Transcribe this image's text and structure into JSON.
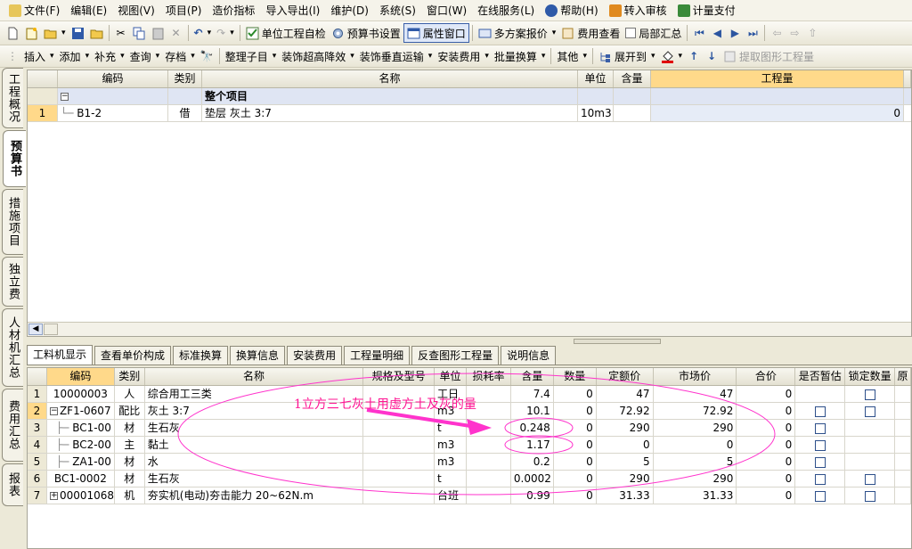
{
  "menu": [
    {
      "label": "文件(F)",
      "icon": "file-menu-icon"
    },
    {
      "label": "编辑(E)"
    },
    {
      "label": "视图(V)"
    },
    {
      "label": "项目(P)"
    },
    {
      "label": "造价指标"
    },
    {
      "label": "导入导出(I)"
    },
    {
      "label": "维护(D)"
    },
    {
      "label": "系统(S)"
    },
    {
      "label": "窗口(W)"
    },
    {
      "label": "在线服务(L)"
    },
    {
      "label": "帮助(H)",
      "icon": "help-icon"
    },
    {
      "label": "转入审核",
      "icon": "audit-icon"
    },
    {
      "label": "计量支付",
      "icon": "payment-icon"
    }
  ],
  "toolbar1": {
    "unit_check": "单位工程自检",
    "budget_settings": "预算书设置",
    "property_window": "属性窗口",
    "multi_quote": "多方案报价",
    "fee_view": "费用查看",
    "partial_sum": "局部汇总"
  },
  "toolbar2": {
    "insert": "插入",
    "add": "添加",
    "supplement": "补充",
    "query": "查询",
    "archive": "存档",
    "arrange": "整理子目",
    "deco_height": "装饰超高降效",
    "deco_transport": "装饰垂直运输",
    "install_fee": "安装费用",
    "batch_convert": "批量换算",
    "other": "其他",
    "expand_to": "展开到",
    "extract_qty": "提取图形工程量"
  },
  "side_tabs": [
    "工程概况",
    "预算书",
    "措施项目",
    "独立费",
    "人材机汇总",
    "费用汇总",
    "报表"
  ],
  "upper_grid": {
    "headers": [
      "编码",
      "类别",
      "名称",
      "单位",
      "含量",
      "工程量"
    ],
    "group_row": {
      "name": "整个项目",
      "toggle": "−"
    },
    "rows": [
      {
        "num": "1",
        "code": "B1-2",
        "type": "借",
        "name": "垫层 灰土 3:7",
        "unit": "10m3",
        "content": "",
        "qty": "0"
      }
    ]
  },
  "bottom_tabs": [
    "工料机显示",
    "查看单价构成",
    "标准换算",
    "换算信息",
    "安装费用",
    "工程量明细",
    "反查图形工程量",
    "说明信息"
  ],
  "lower_grid": {
    "headers": [
      "编码",
      "类别",
      "名称",
      "规格及型号",
      "单位",
      "损耗率",
      "含量",
      "数量",
      "定额价",
      "市场价",
      "合价",
      "是否暂估",
      "锁定数量",
      "原"
    ],
    "rows": [
      {
        "num": "1",
        "code": "10000003",
        "type": "人",
        "name": "综合用工三类",
        "spec": "",
        "unit": "工日",
        "loss": "",
        "content": "7.4",
        "qty": "0",
        "price": "47",
        "market": "47",
        "total": "0",
        "prov": false,
        "lock": true,
        "prefix": ""
      },
      {
        "num": "2",
        "code": "ZF1-0607",
        "type": "配比",
        "name": "灰土 3:7",
        "spec": "",
        "unit": "m3",
        "loss": "",
        "content": "10.1",
        "qty": "0",
        "price": "72.92",
        "market": "72.92",
        "total": "0",
        "prov": true,
        "lock": true,
        "prefix": "−"
      },
      {
        "num": "3",
        "code": "BC1-00",
        "type": "材",
        "name": "生石灰",
        "spec": "",
        "unit": "t",
        "loss": "",
        "content": "0.248",
        "qty": "0",
        "price": "290",
        "market": "290",
        "total": "0",
        "prov": true,
        "lock": false,
        "prefix": "child"
      },
      {
        "num": "4",
        "code": "BC2-00",
        "type": "主",
        "name": "黏土",
        "spec": "",
        "unit": "m3",
        "loss": "",
        "content": "1.17",
        "qty": "0",
        "price": "0",
        "market": "0",
        "total": "0",
        "prov": true,
        "lock": false,
        "prefix": "child"
      },
      {
        "num": "5",
        "code": "ZA1-00",
        "type": "材",
        "name": "水",
        "spec": "",
        "unit": "m3",
        "loss": "",
        "content": "0.2",
        "qty": "0",
        "price": "5",
        "market": "5",
        "total": "0",
        "prov": true,
        "lock": false,
        "prefix": "child"
      },
      {
        "num": "6",
        "code": "BC1-0002",
        "type": "材",
        "name": "生石灰",
        "spec": "",
        "unit": "t",
        "loss": "",
        "content": "0.0002",
        "qty": "0",
        "price": "290",
        "market": "290",
        "total": "0",
        "prov": true,
        "lock": true,
        "prefix": ""
      },
      {
        "num": "7",
        "code": "00001068",
        "type": "机",
        "name": "夯实机(电动)夯击能力 20~62N.m",
        "spec": "",
        "unit": "台班",
        "loss": "",
        "content": "0.99",
        "qty": "0",
        "price": "31.33",
        "market": "31.33",
        "total": "0",
        "prov": true,
        "lock": true,
        "prefix": "+"
      }
    ]
  },
  "annotation": {
    "text": "1立方三七灰土用虚方土及灰的量",
    "color": "#ff1493"
  }
}
